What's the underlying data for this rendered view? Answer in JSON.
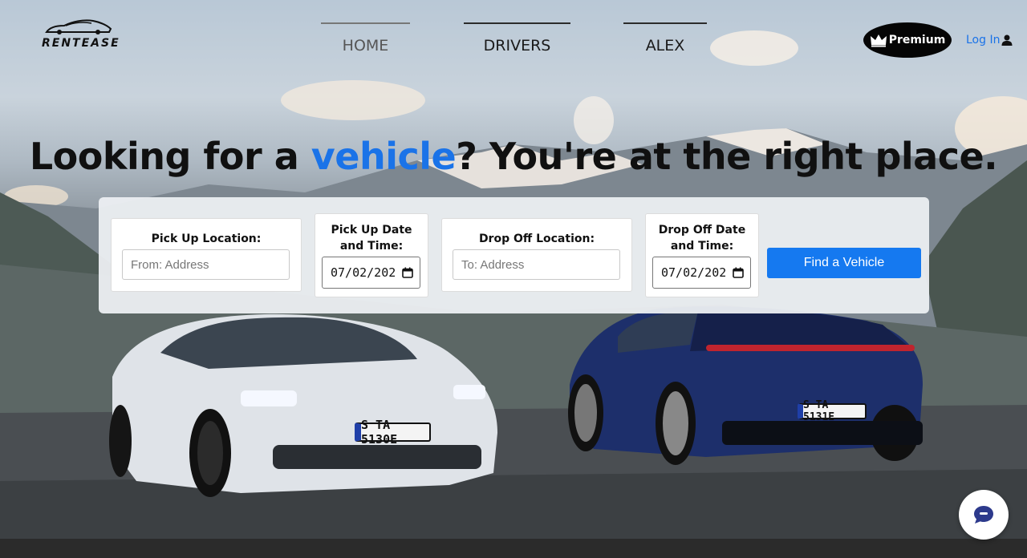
{
  "brand": {
    "name": "RENTEASE"
  },
  "nav": {
    "home": "HOME",
    "drivers": "DRIVERS",
    "alex": "ALEX"
  },
  "header": {
    "premium_label": "Premium",
    "login_label": "Log In"
  },
  "hero": {
    "headline_pre": "Looking for a ",
    "headline_accent": "vehicle",
    "headline_post": "? You're at the right place."
  },
  "search": {
    "pickup_location_label": "Pick Up Location:",
    "pickup_location_placeholder": "From: Address",
    "pickup_date_label": "Pick Up Date and Time:",
    "pickup_date_value": "07/02/202",
    "dropoff_location_label": "Drop Off Location:",
    "dropoff_location_placeholder": "To: Address",
    "dropoff_date_label": "Drop Off Date and Time:",
    "dropoff_date_value": "07/02/202",
    "find_button": "Find a Vehicle"
  },
  "cars": {
    "plate_left": "S TA 5130E",
    "plate_right": "S TA 5131E"
  },
  "colors": {
    "accent": "#1a73e8",
    "button": "#1579f0"
  },
  "icons": {
    "crown": "crown-icon",
    "user": "user-icon",
    "chat": "chat-icon",
    "calendar": "calendar-icon",
    "car_logo": "car-logo-icon"
  }
}
